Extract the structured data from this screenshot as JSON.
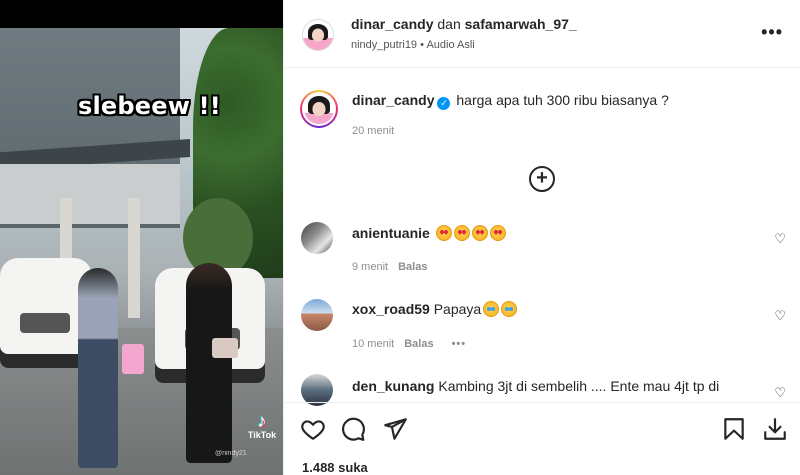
{
  "media": {
    "overlay_caption": "slebeew !!",
    "tiktok_label": "TikTok",
    "tiktok_handle": "@nindy21"
  },
  "header": {
    "user1": "dinar_candy",
    "joiner": "dan",
    "user2": "safamarwah_97_",
    "audio_user": "nindy_putri19",
    "separator": "•",
    "audio_label": "Audio Asli",
    "more": "•••"
  },
  "caption": {
    "username": "dinar_candy",
    "verified_mark": "✓",
    "text": "harga apa tuh 300 ribu biasanya ?",
    "time": "20 menit"
  },
  "load_more": "+",
  "comments": [
    {
      "username": "anientuanie",
      "text": "",
      "emoji_count": 4,
      "time": "9 menit",
      "reply": "Balas"
    },
    {
      "username": "xox_road59",
      "text": "Papaya",
      "emoji_count": 2,
      "time": "10 menit",
      "reply": "Balas",
      "more": "•••"
    },
    {
      "username": "den_kunang",
      "text": "Kambing 3jt di sembelih .... Ente mau 4jt tp di"
    }
  ],
  "likes": "1.488 suka",
  "icons": [
    "heart-icon",
    "comment-icon",
    "share-icon",
    "save-icon",
    "download-icon",
    "more-icon",
    "plus-circle-icon",
    "verified-icon"
  ],
  "colors": {
    "verified": "#0095f6",
    "text": "#262626",
    "muted": "#8e8e8e"
  }
}
